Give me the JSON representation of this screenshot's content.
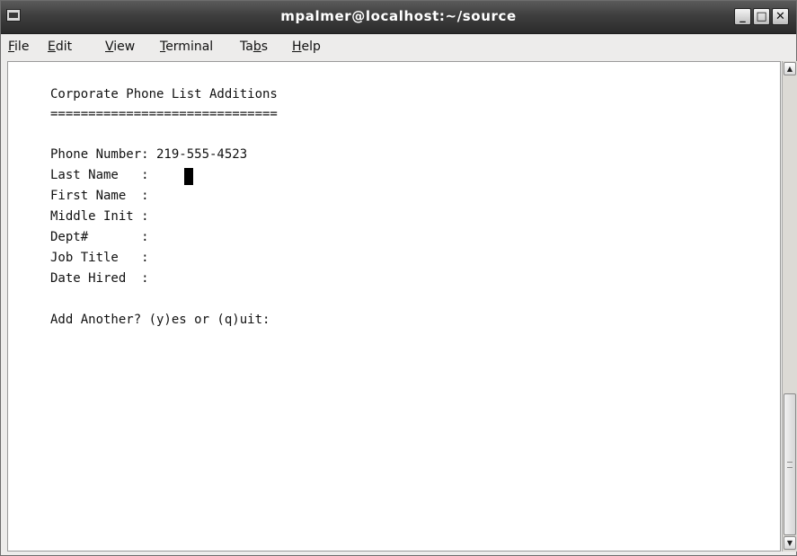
{
  "window": {
    "title": "mpalmer@localhost:~/source",
    "minimize_glyph": "_",
    "maximize_glyph": "□",
    "close_glyph": "✕"
  },
  "menu": {
    "items": [
      {
        "ul": "F",
        "rest": "ile"
      },
      {
        "ul": "E",
        "rest": "dit"
      },
      {
        "ul": "V",
        "rest": "iew"
      },
      {
        "ul": "T",
        "rest": "erminal"
      },
      {
        "pre": "Ta",
        "ul": "b",
        "rest": "s"
      },
      {
        "ul": "H",
        "rest": "elp"
      }
    ]
  },
  "terminal": {
    "lines": [
      "Corporate Phone List Additions",
      "==============================",
      "",
      "Phone Number: 219-555-4523",
      "Last Name   :",
      "First Name  :",
      "Middle Init :",
      "Dept#       :",
      "Job Title   :",
      "Date Hired  :",
      "",
      "Add Another? (y)es or (q)uit:"
    ]
  },
  "scrollbar": {
    "up_glyph": "▲",
    "down_glyph": "▼"
  }
}
